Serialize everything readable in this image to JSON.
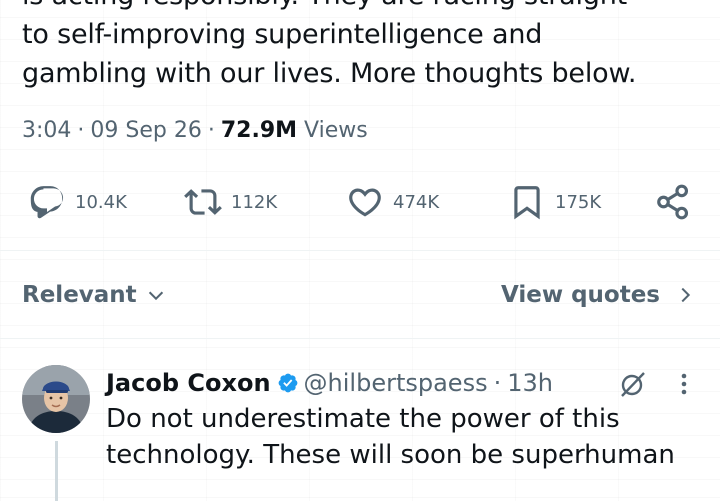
{
  "tweet": {
    "text_lines": [
      "is acting responsibly. They are racing straight",
      "to self-improving superintelligence and",
      "gambling with our lives. More thoughts below."
    ],
    "time": "3:04",
    "date": "09 Sep 26",
    "views_count": "72.9M",
    "views_label": "Views",
    "separator": "·"
  },
  "actions": {
    "replies": "10.4K",
    "reposts": "112K",
    "likes": "474K",
    "bookmarks": "175K"
  },
  "sort": {
    "label": "Relevant",
    "view_quotes": "View quotes"
  },
  "reply": {
    "name": "Jacob Coxon",
    "handle": "@hilbertspaess",
    "separator": "·",
    "time": "13h",
    "text_lines": [
      "Do not underestimate the power of this",
      "technology. These will soon be superhuman"
    ]
  },
  "colors": {
    "text_primary": "#0f1419",
    "text_secondary": "#536471",
    "verified_blue": "#1d9bf0",
    "divider": "#eff3f4"
  }
}
